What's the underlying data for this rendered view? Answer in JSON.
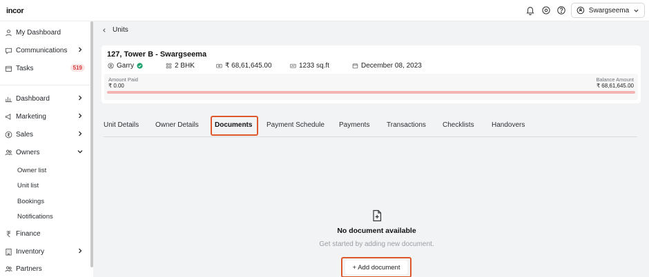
{
  "app": {
    "logo": "incor"
  },
  "header": {
    "user": "Swargseema"
  },
  "sidebar": {
    "items": [
      {
        "label": "My Dashboard"
      },
      {
        "label": "Communications"
      },
      {
        "label": "Tasks",
        "badge": "519"
      },
      {
        "label": "Dashboard"
      },
      {
        "label": "Marketing"
      },
      {
        "label": "Sales"
      },
      {
        "label": "Owners"
      },
      {
        "label": "Finance"
      },
      {
        "label": "Inventory"
      },
      {
        "label": "Partners"
      }
    ],
    "owners_sub": [
      "Owner list",
      "Unit list",
      "Bookings",
      "Notifications"
    ]
  },
  "breadcrumb": {
    "label": "Units"
  },
  "unit": {
    "title": "127, Tower B - Swargseema",
    "owner": "Garry",
    "type": "2 BHK",
    "price": "₹ 68,61,645.00",
    "area": "1233 sq.ft",
    "date": "December 08, 2023",
    "amount_paid_label": "Amount Paid",
    "amount_paid": "₹ 0.00",
    "balance_label": "Balance Amount",
    "balance": "₹ 68,61,645.00",
    "paid_fraction": 0
  },
  "tabs": [
    "Unit Details",
    "Owner Details",
    "Documents",
    "Payment Schedule",
    "Payments",
    "Transactions",
    "Checklists",
    "Handovers"
  ],
  "active_tab": "Documents",
  "empty_state": {
    "title": "No document available",
    "subtitle": "Get started by adding new document.",
    "button": "+ Add document"
  },
  "colors": {
    "accent": "#e0562b",
    "progress_bg": "#f4b4b4",
    "badge_text": "#d93a3a",
    "verified": "#1fa36b"
  }
}
